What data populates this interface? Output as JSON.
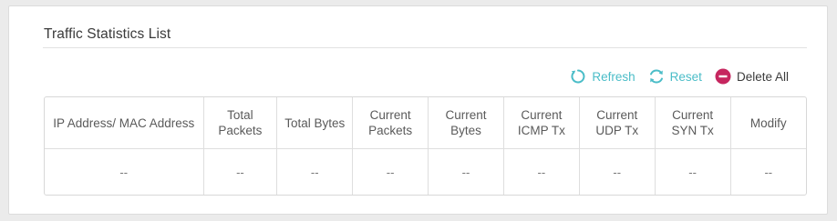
{
  "section": {
    "title": "Traffic Statistics List"
  },
  "toolbar": {
    "refresh_label": "Refresh",
    "reset_label": "Reset",
    "delete_all_label": "Delete All",
    "accent_color": "#4bbdc8",
    "delete_color": "#c6265f"
  },
  "table": {
    "columns": [
      "IP Address/ MAC Address",
      "Total Packets",
      "Total Bytes",
      "Current Packets",
      "Current Bytes",
      "Current ICMP Tx",
      "Current UDP Tx",
      "Current SYN Tx",
      "Modify"
    ],
    "rows": [
      [
        "--",
        "--",
        "--",
        "--",
        "--",
        "--",
        "--",
        "--",
        "--"
      ]
    ]
  }
}
